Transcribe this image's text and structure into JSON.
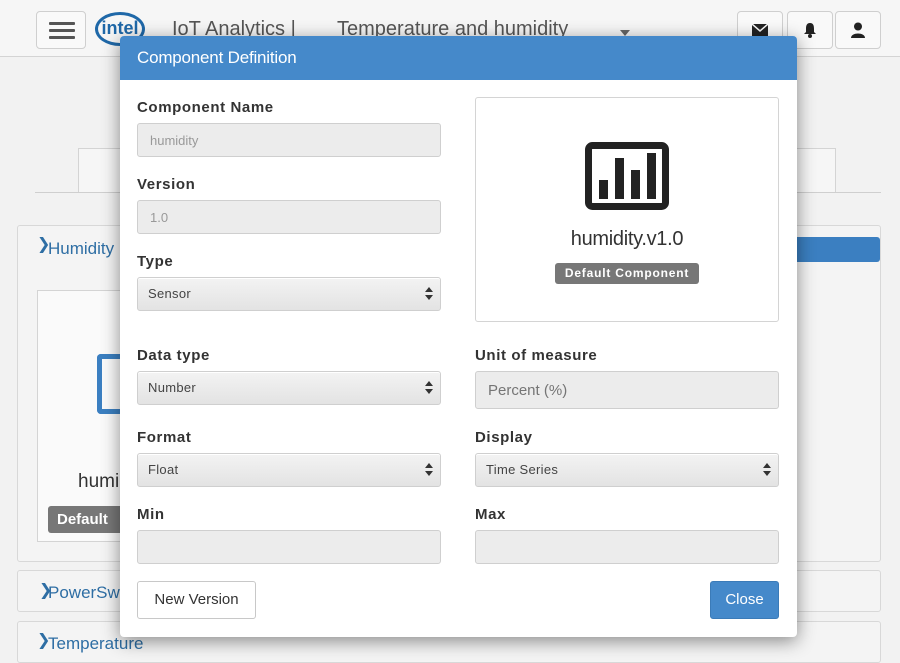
{
  "background": {
    "app_logo": "intel",
    "app_name": "IoT Analytics |",
    "page_title": "Temperature and humidity",
    "panels": [
      {
        "title": "Humidity"
      },
      {
        "title": "PowerSwitch"
      },
      {
        "title": "Temperature"
      }
    ],
    "card": {
      "name": "humi",
      "badge": "Default"
    }
  },
  "modal": {
    "title": "Component Definition",
    "component_name": {
      "label": "Component Name",
      "value": "humidity"
    },
    "version": {
      "label": "Version",
      "value": "1.0"
    },
    "type": {
      "label": "Type",
      "value": "Sensor"
    },
    "data_type": {
      "label": "Data type",
      "value": "Number"
    },
    "unit_of_measure": {
      "label": "Unit of measure",
      "value": "Percent (%)"
    },
    "format": {
      "label": "Format",
      "value": "Float"
    },
    "display": {
      "label": "Display",
      "value": "Time Series"
    },
    "min": {
      "label": "Min",
      "value": ""
    },
    "max": {
      "label": "Max",
      "value": ""
    },
    "preview": {
      "name": "humidity.v1.0",
      "badge": "Default Component",
      "icon": "bar-chart-icon"
    },
    "new_version_label": "New Version",
    "close_label": "Close"
  },
  "colors": {
    "header": "#4589ca",
    "badge": "#777777",
    "primary_button": "#4589ca"
  }
}
